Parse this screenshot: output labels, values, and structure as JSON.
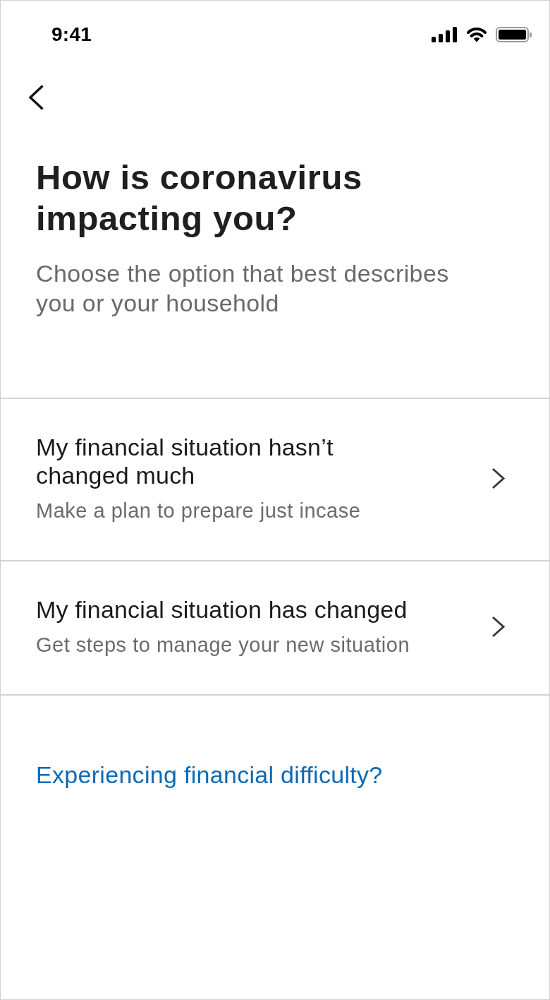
{
  "status_bar": {
    "time": "9:41"
  },
  "header": {
    "title": "How is coronavirus impacting you?",
    "subtitle": "Choose the option that best describes you or your household"
  },
  "options": [
    {
      "title": "My financial situation hasn’t changed much",
      "subtitle": "Make a plan to prepare just incase"
    },
    {
      "title": "My financial situation has changed",
      "subtitle": "Get steps to manage your new situation"
    }
  ],
  "link": {
    "label": "Experiencing financial difficulty?"
  }
}
